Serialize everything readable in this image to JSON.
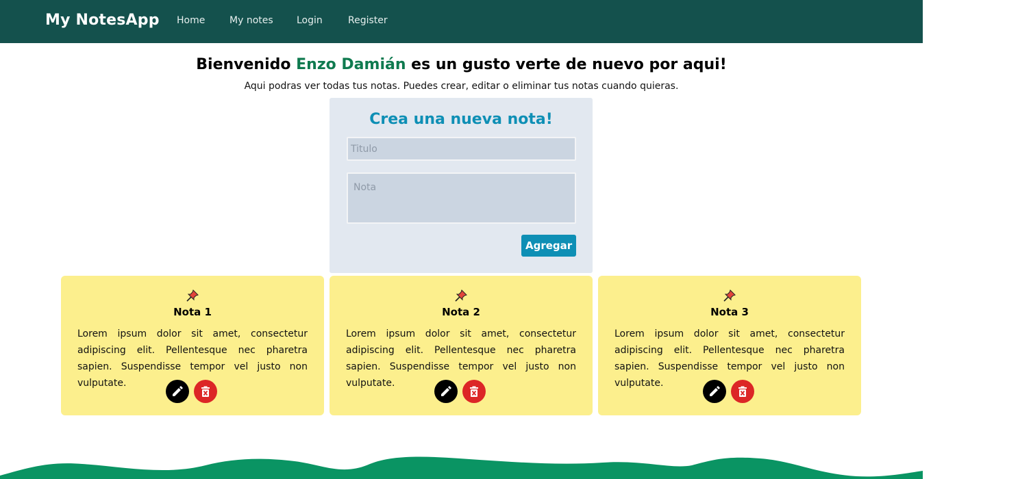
{
  "navbar": {
    "brand": "My NotesApp",
    "links": [
      "Home",
      "My notes",
      "Login",
      "Register"
    ]
  },
  "welcome": {
    "prefix": "Bienvenido ",
    "user_name": "Enzo Damián",
    "suffix": " es un gusto verte de nuevo por aqui!",
    "subtitle": "Aqui podras ver todas tus notas. Puedes crear, editar o eliminar tus notas cuando quieras."
  },
  "form": {
    "title": "Crea una nueva nota!",
    "title_placeholder": "Titulo",
    "note_placeholder": "Nota",
    "submit_label": "Agregar"
  },
  "notes": [
    {
      "title": "Nota 1",
      "body": "Lorem ipsum dolor sit amet, consectetur adipiscing elit. Pellentesque nec pharetra sapien. Suspendisse tempor vel justo non vulputate."
    },
    {
      "title": "Nota 2",
      "body": "Lorem ipsum dolor sit amet, consectetur adipiscing elit. Pellentesque nec pharetra sapien. Suspendisse tempor vel justo non vulputate."
    },
    {
      "title": "Nota 3",
      "body": "Lorem ipsum dolor sit amet, consectetur adipiscing elit. Pellentesque nec pharetra sapien. Suspendisse tempor vel justo non vulputate."
    }
  ],
  "icons": {
    "pin": "pushpin-icon",
    "edit": "pencil-icon",
    "delete": "trash-icon"
  },
  "colors": {
    "navbar": "#14514d",
    "accent": "#0e8fb5",
    "user_name": "#0f7a4f",
    "note_card": "#fcef8d",
    "form_card": "#e2e8f0",
    "delete": "#dc2626",
    "wave": "#0a9463"
  }
}
